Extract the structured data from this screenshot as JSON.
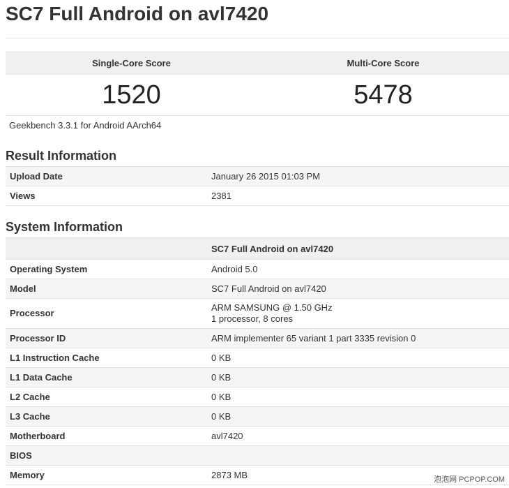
{
  "title": "SC7 Full Android on avl7420",
  "scores": {
    "single_label": "Single-Core Score",
    "multi_label": "Multi-Core Score",
    "single_value": "1520",
    "multi_value": "5478"
  },
  "benchmark_version": "Geekbench 3.3.1 for Android AArch64",
  "result_info": {
    "heading": "Result Information",
    "rows": [
      {
        "key": "Upload Date",
        "value": "January 26 2015 01:03 PM"
      },
      {
        "key": "Views",
        "value": "2381"
      }
    ]
  },
  "system_info": {
    "heading": "System Information",
    "device_header": "SC7 Full Android on avl7420",
    "rows": [
      {
        "key": "Operating System",
        "value": "Android 5.0"
      },
      {
        "key": "Model",
        "value": "SC7 Full Android on avl7420"
      },
      {
        "key": "Processor",
        "value": "ARM SAMSUNG @ 1.50 GHz",
        "value2": "1 processor, 8 cores"
      },
      {
        "key": "Processor ID",
        "value": "ARM implementer 65 variant 1 part 3335 revision 0"
      },
      {
        "key": "L1 Instruction Cache",
        "value": "0 KB"
      },
      {
        "key": "L1 Data Cache",
        "value": "0 KB"
      },
      {
        "key": "L2 Cache",
        "value": "0 KB"
      },
      {
        "key": "L3 Cache",
        "value": "0 KB"
      },
      {
        "key": "Motherboard",
        "value": "avl7420"
      },
      {
        "key": "BIOS",
        "value": ""
      },
      {
        "key": "Memory",
        "value": "2873 MB"
      }
    ]
  },
  "watermark": "泡泡网 PCPOP.COM"
}
